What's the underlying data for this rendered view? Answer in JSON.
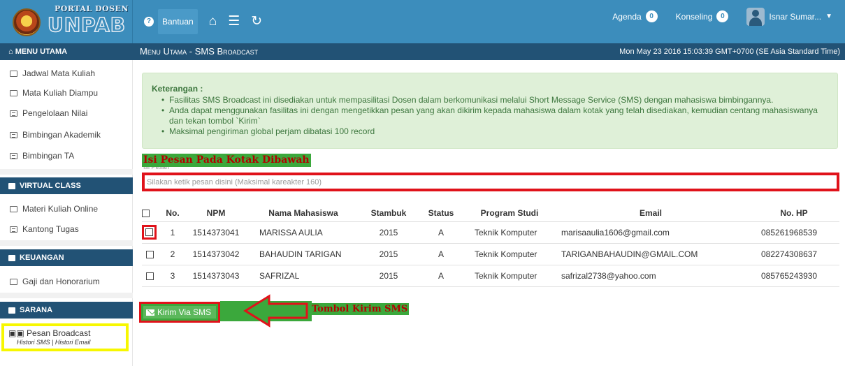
{
  "header": {
    "logo_top": "PORTAL DOSEN",
    "logo_main": "UNPAB",
    "help_label": "Bantuan",
    "agenda_label": "Agenda",
    "agenda_count": "0",
    "konseling_label": "Konseling",
    "konseling_count": "0",
    "user_name": "Isnar Sumar..."
  },
  "subheader": {
    "menu_title": "MENU UTAMA",
    "page_title": "Menu Utama - SMS Broadcast",
    "datetime": "Mon May 23 2016 15:03:39 GMT+0700 (SE Asia Standard Time)"
  },
  "sidebar": {
    "menu_items": [
      {
        "label": "Jadwal Mata Kuliah",
        "icon": "calendar-icon"
      },
      {
        "label": "Mata Kuliah Diampu",
        "icon": "copy-icon"
      },
      {
        "label": "Pengelolaan Nilai",
        "icon": "list-icon"
      },
      {
        "label": "Bimbingan Akademik",
        "icon": "list-icon"
      },
      {
        "label": "Bimbingan TA",
        "icon": "list-icon"
      }
    ],
    "virtual_title": "VIRTUAL CLASS",
    "virtual_items": [
      {
        "label": "Materi Kuliah Online",
        "icon": "tag-icon"
      },
      {
        "label": "Kantong Tugas",
        "icon": "list-icon"
      }
    ],
    "keuangan_title": "KEUANGAN",
    "keuangan_items": [
      {
        "label": "Gaji dan Honorarium",
        "icon": "money-icon"
      }
    ],
    "sarana_title": "SARANA",
    "pesan_title": "Pesan Broadcast",
    "pesan_sub": "Histori SMS | Histori Email"
  },
  "info": {
    "title": "Keterangan :",
    "items": [
      "Fasilitas SMS Broadcast ini disediakan untuk mempasilitasi Dosen dalam berkomunikasi melalui Short Message Service (SMS) dengan mahasiswa bimbingannya.",
      "Anda dapat menggunakan fasilitas ini dengan mengetikkan pesan yang akan dikirim kepada mahasiswa dalam kotak yang telah disediakan, kemudian centang mahasiswanya dan tekan tombol `Kirim`",
      "Maksimal pengiriman global perjam dibatasi 100 record"
    ]
  },
  "message": {
    "annotation": "Isi Pesan Pada Kotak Dibawah",
    "under_label": "Isi Pesan",
    "placeholder": "Silakan ketik pesan disini (Maksimal kareakter 160)"
  },
  "table": {
    "headers": [
      "No.",
      "NPM",
      "Nama Mahasiswa",
      "Stambuk",
      "Status",
      "Program Studi",
      "Email",
      "No. HP"
    ],
    "rows": [
      {
        "no": "1",
        "npm": "1514373041",
        "nama": "MARISSA AULIA",
        "stambuk": "2015",
        "status": "A",
        "prodi": "Teknik Komputer",
        "email": "marisaaulia1606@gmail.com",
        "hp": "085261968539"
      },
      {
        "no": "2",
        "npm": "1514373042",
        "nama": "BAHAUDIN TARIGAN",
        "stambuk": "2015",
        "status": "A",
        "prodi": "Teknik Komputer",
        "email": "TARIGANBAHAUDIN@GMAIL.COM",
        "hp": "082274308637"
      },
      {
        "no": "3",
        "npm": "1514373043",
        "nama": "SAFRIZAL",
        "stambuk": "2015",
        "status": "A",
        "prodi": "Teknik Komputer",
        "email": "safrizal2738@yahoo.com",
        "hp": "085765243930"
      }
    ]
  },
  "actions": {
    "send_label": "Kirim Via SMS",
    "send_annotation": "Tombol Kirim SMS"
  },
  "colors": {
    "header_blue": "#3c8dbc",
    "subheader_navy": "#225275",
    "info_green": "#dff0d8",
    "annotation_red": "#e0121a",
    "annotation_yellow": "#f7f700",
    "annotation_green": "#3ba83c"
  }
}
